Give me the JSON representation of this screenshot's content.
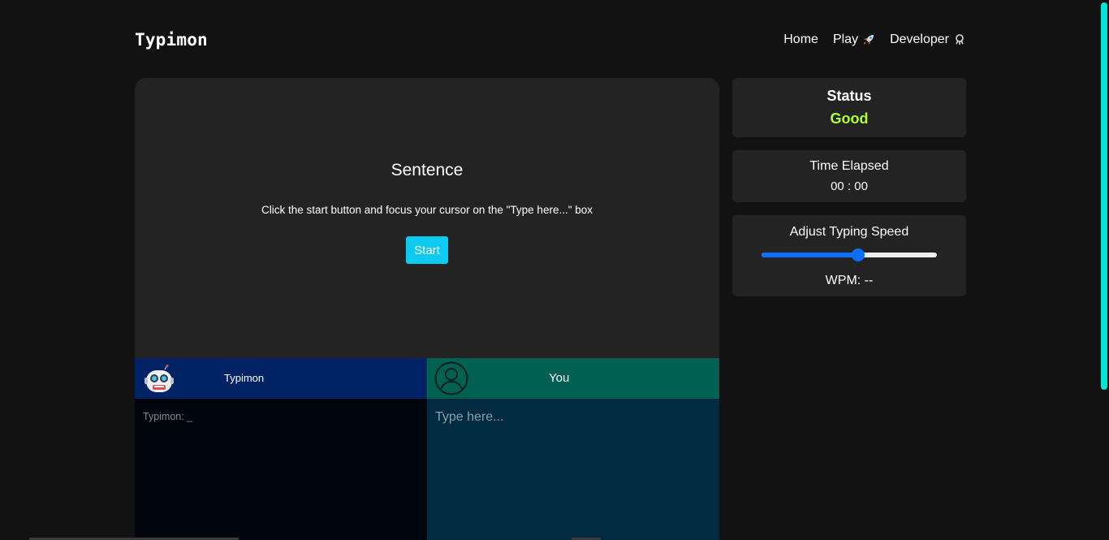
{
  "navbar": {
    "brand": "Typimon",
    "links": [
      {
        "label": "Home",
        "icon": null
      },
      {
        "label": "Play",
        "icon": "rocket-icon"
      },
      {
        "label": "Developer",
        "icon": "developer-icon"
      }
    ]
  },
  "game": {
    "title": "Sentence",
    "instruction": "Click the start button and focus your cursor on the \"Type here...\" box",
    "start_label": "Start",
    "bot": {
      "name": "Typimon",
      "avatar": "robot-icon",
      "output": "Typimon: _"
    },
    "player": {
      "name": "You",
      "avatar": "user-icon",
      "input_value": "",
      "input_placeholder": "Type here..."
    }
  },
  "status": {
    "title": "Status",
    "value": "Good"
  },
  "timer": {
    "title": "Time Elapsed",
    "value": "00 : 00"
  },
  "speed": {
    "title": "Adjust Typing Speed",
    "slider_fraction": 0.55,
    "wpm_label": "WPM: --"
  },
  "colors": {
    "background": "#121212",
    "card": "#232323",
    "accent": "#0dcaf0",
    "status_good": "#adff2f",
    "bot_bar": "#002366",
    "you_bar": "#006052",
    "slider": "#0d6efd"
  }
}
